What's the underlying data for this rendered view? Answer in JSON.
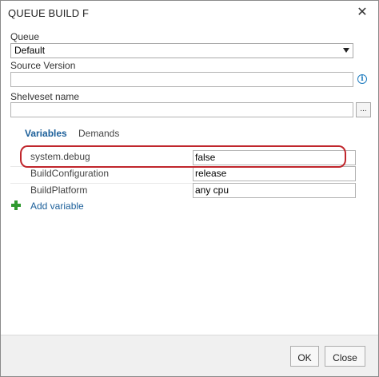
{
  "dialog": {
    "title": "QUEUE BUILD FOR",
    "close_glyph": "✕"
  },
  "queue": {
    "label": "Queue",
    "selected": "Default"
  },
  "source_version": {
    "label": "Source Version",
    "value": ""
  },
  "shelveset": {
    "label": "Shelveset name",
    "value": "",
    "browse_label": "..."
  },
  "tabs": [
    {
      "label": "Variables",
      "active": true
    },
    {
      "label": "Demands",
      "active": false
    }
  ],
  "variables": [
    {
      "name": "system.debug",
      "value": "false"
    },
    {
      "name": "BuildConfiguration",
      "value": "release"
    },
    {
      "name": "BuildPlatform",
      "value": "any cpu"
    }
  ],
  "add_variable_label": "Add variable",
  "buttons": {
    "ok": "OK",
    "close": "Close"
  },
  "colors": {
    "tab_active": "#1a5e99",
    "highlight": "#c0262c",
    "add_icon": "#2f9a2f",
    "info_icon": "#1e7bbf"
  }
}
